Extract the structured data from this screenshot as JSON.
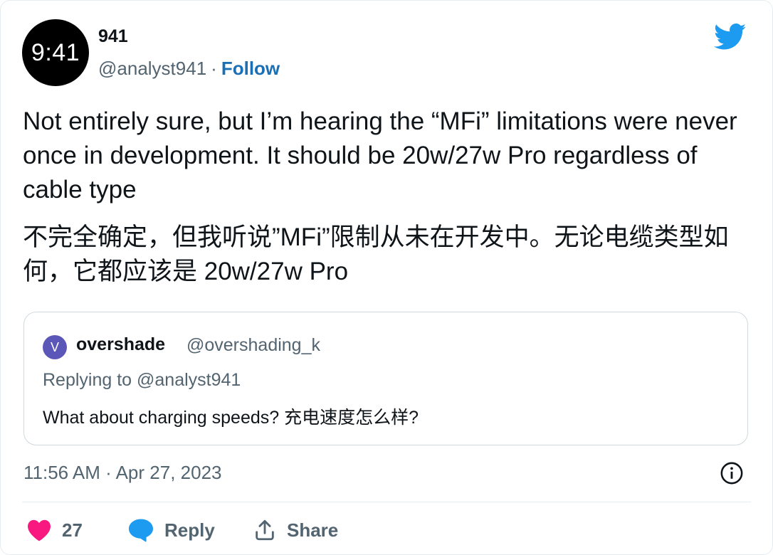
{
  "author": {
    "avatar_text": "9:41",
    "display_name": "941",
    "handle": "@analyst941",
    "separator": "·",
    "follow_label": "Follow"
  },
  "tweet": {
    "text_en": "Not entirely sure, but I’m hearing the “MFi” limitations were never once in development. It should be 20w/27w Pro regardless of cable type",
    "text_zh": "不完全确定，但我听说”MFi”限制从未在开发中。无论电缆类型如何，它都应该是 20w/27w Pro",
    "timestamp": "11:56 AM · Apr 27, 2023"
  },
  "quoted": {
    "avatar_letter": "V",
    "name": "overshade",
    "handle": "@overshading_k",
    "replying_to": "Replying to @analyst941",
    "text": "What about charging speeds? 充电速度怎么样?"
  },
  "actions": {
    "like_count": "27",
    "reply_label": "Reply",
    "share_label": "Share"
  },
  "icons": {
    "logo": "twitter-bird-icon",
    "info": "info-icon",
    "like": "heart-icon",
    "reply": "speech-bubble-icon",
    "share": "share-upload-icon"
  },
  "colors": {
    "brand": "#1d9bf0",
    "follow": "#1b6fb5",
    "heart": "#f91880",
    "reply": "#1d9bf0",
    "muted": "#536471",
    "quoted_avatar": "#5b57b8"
  }
}
